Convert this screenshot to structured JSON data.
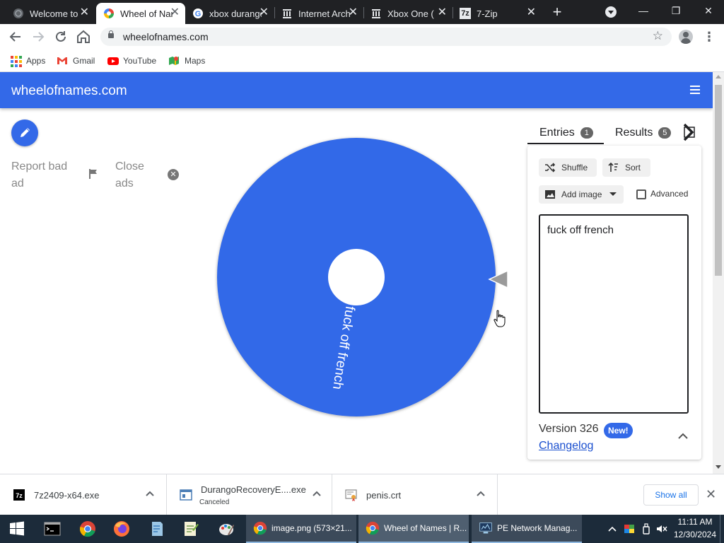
{
  "browser": {
    "tabs": [
      {
        "label": "Welcome to",
        "icon": "globe-icon"
      },
      {
        "label": "Wheel of Names",
        "icon": "wheel-of-names-icon",
        "active": true
      },
      {
        "label": "xbox durango",
        "icon": "google-icon"
      },
      {
        "label": "Internet Archive",
        "icon": "archive-icon"
      },
      {
        "label": "Xbox One (",
        "icon": "archive-icon"
      },
      {
        "label": "7-Zip",
        "icon": "7zip-icon"
      }
    ],
    "url": "wheelofnames.com",
    "bookmarks": [
      {
        "label": "Apps",
        "icon": "apps-grid-icon"
      },
      {
        "label": "Gmail",
        "icon": "gmail-icon"
      },
      {
        "label": "YouTube",
        "icon": "youtube-icon"
      },
      {
        "label": "Maps",
        "icon": "maps-icon"
      }
    ]
  },
  "page": {
    "site_title": "wheelofnames.com",
    "report_ad": "Report bad ad",
    "close_ads": "Close ads",
    "wheel_label": "fuck off french",
    "colors": {
      "brand": "#3369e8",
      "wheel": "#3369e8"
    }
  },
  "panel": {
    "entries_tab": "Entries",
    "entries_count": "1",
    "results_tab": "Results",
    "results_count": "5",
    "shuffle": "Shuffle",
    "sort": "Sort",
    "add_image": "Add image",
    "advanced": "Advanced",
    "entries_text": "fuck off french",
    "version": "Version 326",
    "new_badge": "New!",
    "changelog": "Changelog"
  },
  "downloads": {
    "items": [
      {
        "name": "7z2409-x64.exe",
        "status": ""
      },
      {
        "name": "DurangoRecoveryE....exe",
        "status": "Canceled"
      },
      {
        "name": "penis.crt",
        "status": ""
      }
    ],
    "show_all": "Show all"
  },
  "taskbar": {
    "tasks": [
      {
        "label": "image.png (573×21..."
      },
      {
        "label": "Wheel of Names | R...",
        "active": true
      },
      {
        "label": "PE Network Manag..."
      }
    ],
    "time": "11:11 AM",
    "date": "12/30/2024"
  }
}
